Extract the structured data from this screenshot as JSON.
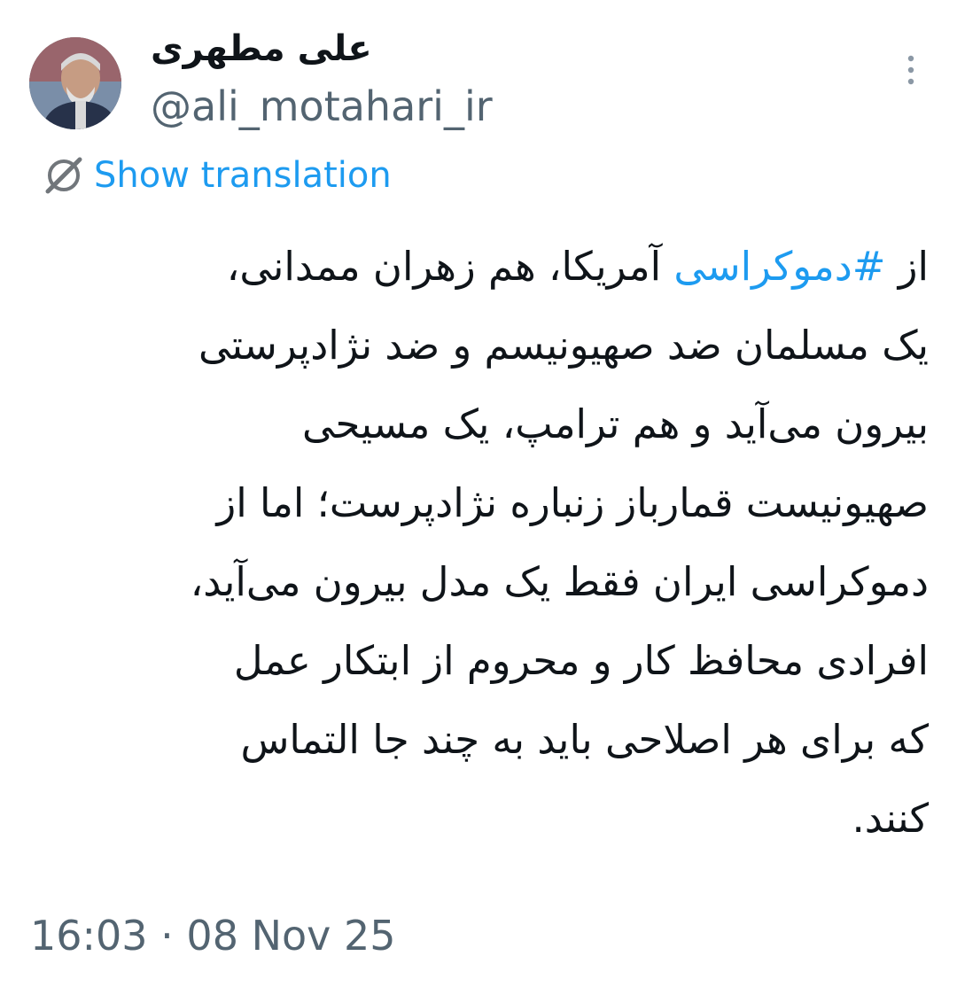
{
  "author": {
    "display_name": "علی مطهری",
    "handle": "@ali_motahari_ir"
  },
  "icons": {
    "more": "more-vertical-icon",
    "translate": "globe-slash-icon"
  },
  "translation": {
    "label": "Show translation"
  },
  "tweet": {
    "line1_prefix": "از ",
    "hashtag": "#دموکراسی",
    "line1_suffix": " آمریکا، هم زهران ممدانی،",
    "lines": [
      "یک مسلمان ضد صهیونیسم و ضد نژادپرستی",
      "بیرون می‌آید و هم ترامپ، یک مسیحی",
      "صهیونیست قمارباز زنباره نژادپرست؛ اما از",
      "دموکراسی ایران فقط یک مدل بیرون می‌آید،",
      "افرادی محافظ کار و محروم از ابتکار عمل",
      "که برای هر اصلاحی باید به چند جا التماس",
      "کنند."
    ]
  },
  "timestamp": "16:03 · 08 Nov 25",
  "colors": {
    "link": "#1d9bf0",
    "secondary_text": "#536471",
    "primary_text": "#0f1419"
  }
}
